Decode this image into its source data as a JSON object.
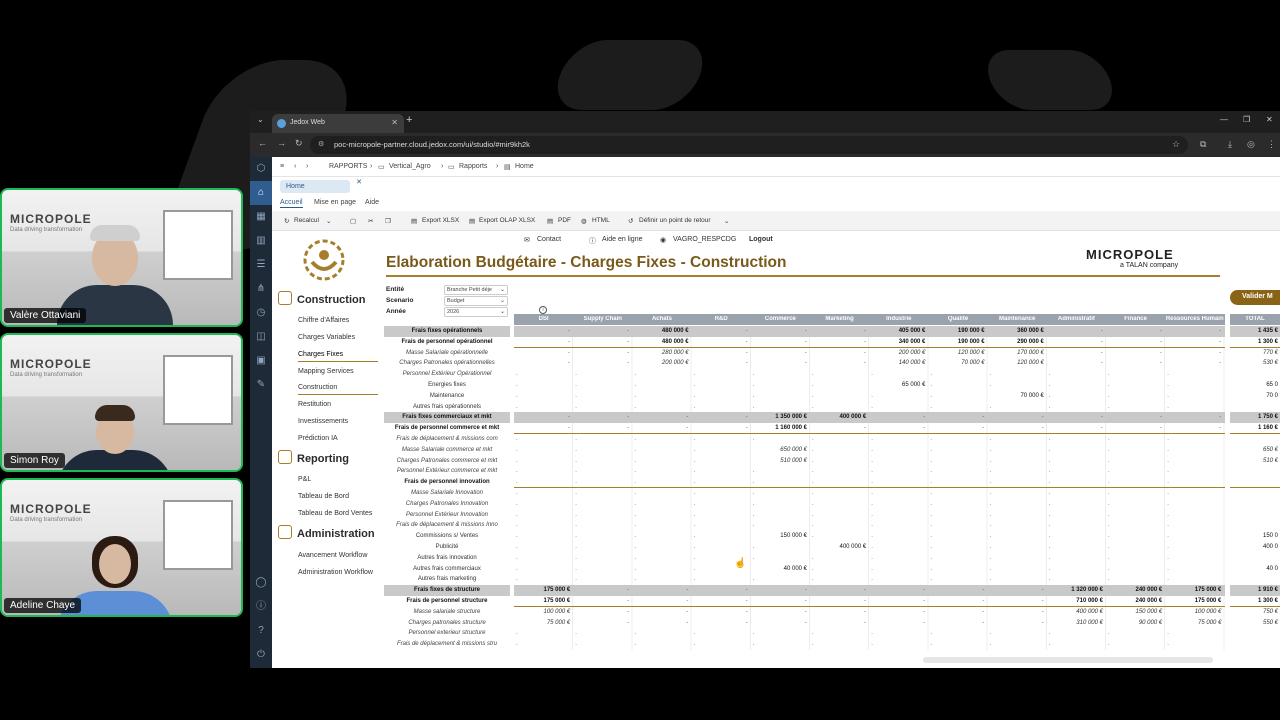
{
  "participants": [
    {
      "name": "Valère Ottaviani",
      "brand": "MICROPOLE",
      "tagline": "Data driving transformation"
    },
    {
      "name": "Simon Roy",
      "brand": "MICROPOLE",
      "tagline": "Data driving transformation"
    },
    {
      "name": "Adeline Chaye",
      "brand": "MICROPOLE",
      "tagline": "Data driving transformation"
    }
  ],
  "browser": {
    "tab_title": "Jedox Web",
    "url": "poc-micropole-partner.cloud.jedox.com/ui/studio/#mir9kh2k"
  },
  "app": {
    "breadcrumb": [
      "RAPPORTS",
      "Vertical_Agro",
      "Rapports",
      "Home"
    ],
    "home_tab": "Home",
    "ribbon_tabs": [
      "Accueil",
      "Mise en page",
      "Aide"
    ],
    "toolbar": {
      "recalcul": "Recalcul",
      "export_xlsx": "Export XLSX",
      "export_olap": "Export OLAP XLSX",
      "pdf": "PDF",
      "html": "HTML",
      "retour": "Définir un point de retour"
    },
    "links": {
      "contact": "Contact",
      "aide": "Aide en ligne",
      "user": "VAGRO_RESPCDG",
      "logout": "Logout"
    }
  },
  "report": {
    "title": "Elaboration Budgétaire - Charges Fixes - Construction",
    "brand": "MICROPOLE",
    "brand_sub": "a TALAN company",
    "filters": [
      {
        "label": "Entité",
        "value": "Branche Petit déje"
      },
      {
        "label": "Scenario",
        "value": "Budget"
      },
      {
        "label": "Année",
        "value": "2026"
      }
    ],
    "validate_label": "Valider M"
  },
  "left_nav": {
    "sections": [
      {
        "title": "Construction",
        "items": [
          "Chiffre d'Affaires",
          "Charges Variables",
          "Charges Fixes",
          "Mapping Services",
          "Construction",
          "Restitution",
          "Investissements",
          "Prédiction IA"
        ]
      },
      {
        "title": "Reporting",
        "items": [
          "P&L",
          "Tableau de Bord",
          "Tableau de Bord Ventes"
        ]
      },
      {
        "title": "Administration",
        "items": [
          "Avancement Workflow",
          "Administration Workflow"
        ]
      }
    ]
  },
  "grid": {
    "columns": [
      "DSI",
      "Supply Chain",
      "Achats",
      "R&D",
      "Commerce",
      "Marketing",
      "Industrie",
      "Qualité",
      "Maintenance",
      "Administratif",
      "Finance",
      "Ressources Humain"
    ],
    "total_label": "TOTAL",
    "rows": [
      {
        "label": "Frais fixes opérationnels",
        "kind": "grp",
        "values": {
          "2": "480 000 €",
          "6": "405 000 €",
          "7": "190 000 €",
          "8": "360 000 €"
        },
        "total": "1 435 €",
        "dashes": true
      },
      {
        "label": "Frais de personnel opérationnel",
        "kind": "sub",
        "values": {
          "2": "480 000 €",
          "6": "340 000 €",
          "7": "190 000 €",
          "8": "290 000 €"
        },
        "total": "1 300 €",
        "dashes": true
      },
      {
        "label": "Masse Salariale opérationnelle",
        "kind": "det",
        "values": {
          "2": "280 000 €",
          "6": "200 000 €",
          "7": "120 000 €",
          "8": "170 000 €"
        },
        "total": "770 €",
        "dashes": true
      },
      {
        "label": "Charges Patronales opérationnelles",
        "kind": "det",
        "values": {
          "2": "200 000 €",
          "6": "140 000 €",
          "7": "70 000 €",
          "8": "120 000 €"
        },
        "total": "530 €",
        "dashes": true
      },
      {
        "label": "Personnel Extérieur Opérationnel",
        "kind": "det",
        "values": {},
        "total": "",
        "dashes": false
      },
      {
        "label": "Energies fixes",
        "kind": "plain",
        "values": {
          "6": "65 000 €"
        },
        "total": "65 0",
        "dashes": false
      },
      {
        "label": "Maintenance",
        "kind": "plain",
        "values": {
          "8": "70 000 €"
        },
        "total": "70 0",
        "dashes": false
      },
      {
        "label": "Autres frais opérationnels",
        "kind": "plain",
        "values": {},
        "total": "",
        "dashes": false
      },
      {
        "label": "Frais fixes commerciaux et mkt",
        "kind": "grp",
        "values": {
          "4": "1 350 000 €",
          "5": "400 000 €"
        },
        "total": "1 750 €",
        "dashes": true
      },
      {
        "label": "Frais de personnel commerce et mkt",
        "kind": "sub",
        "values": {
          "4": "1 160 000 €"
        },
        "total": "1 160 €",
        "dashes": true
      },
      {
        "label": "Frais de déplacement & missions com",
        "kind": "det",
        "values": {},
        "total": "",
        "dashes": false
      },
      {
        "label": "Masse Salariale commerce et mkt",
        "kind": "det",
        "values": {
          "4": "650 000 €"
        },
        "total": "650 €",
        "dashes": false
      },
      {
        "label": "Charges Patronales commerce et mkt",
        "kind": "det",
        "values": {
          "4": "510 000 €"
        },
        "total": "510 €",
        "dashes": false
      },
      {
        "label": "Personnel Extérieur commerce et mkt",
        "kind": "det",
        "values": {},
        "total": "",
        "dashes": false
      },
      {
        "label": "Frais de personnel innovation",
        "kind": "sub",
        "values": {},
        "total": "",
        "dashes": false
      },
      {
        "label": "Masse Salariale Innovation",
        "kind": "det",
        "values": {},
        "total": "",
        "dashes": false
      },
      {
        "label": "Charges Patronales Innovation",
        "kind": "det",
        "values": {},
        "total": "",
        "dashes": false
      },
      {
        "label": "Personnel Extérieur Innovation",
        "kind": "det",
        "values": {},
        "total": "",
        "dashes": false
      },
      {
        "label": "Frais de déplacement & missions Inno",
        "kind": "det",
        "values": {},
        "total": "",
        "dashes": false
      },
      {
        "label": "Commissions s/ Ventes",
        "kind": "plain",
        "values": {
          "4": "150 000 €"
        },
        "total": "150 0",
        "dashes": false
      },
      {
        "label": "Publicité",
        "kind": "plain",
        "values": {
          "5": "400 000 €"
        },
        "total": "400 0",
        "dashes": false
      },
      {
        "label": "Autres frais innovation",
        "kind": "plain",
        "values": {},
        "total": "",
        "dashes": false
      },
      {
        "label": "Autres frais commerciaux",
        "kind": "plain",
        "values": {
          "4": "40 000 €"
        },
        "total": "40 0",
        "dashes": false
      },
      {
        "label": "Autres frais marketing",
        "kind": "plain",
        "values": {},
        "total": "",
        "dashes": false
      },
      {
        "label": "Frais fixes de structure",
        "kind": "grp",
        "values": {
          "0": "175 000 €",
          "9": "1 320 000 €",
          "10": "240 000 €",
          "11": "175 000 €"
        },
        "total": "1 910 €",
        "dashes": true
      },
      {
        "label": "Frais de personnel structure",
        "kind": "sub",
        "values": {
          "0": "175 000 €",
          "9": "710 000 €",
          "10": "240 000 €",
          "11": "175 000 €"
        },
        "total": "1 300 €",
        "dashes": true
      },
      {
        "label": "Masse salariale structure",
        "kind": "det",
        "values": {
          "0": "100 000 €",
          "9": "400 000 €",
          "10": "150 000 €",
          "11": "100 000 €"
        },
        "total": "750 €",
        "dashes": true
      },
      {
        "label": "Charges patronales structure",
        "kind": "det",
        "values": {
          "0": "75 000 €",
          "9": "310 000 €",
          "10": "90 000 €",
          "11": "75 000 €"
        },
        "total": "550 €",
        "dashes": true
      },
      {
        "label": "Personnel exterieur structure",
        "kind": "det",
        "values": {},
        "total": "",
        "dashes": false
      },
      {
        "label": "Frais de déplacement & missions stru",
        "kind": "det",
        "values": {},
        "total": "",
        "dashes": false
      }
    ]
  }
}
